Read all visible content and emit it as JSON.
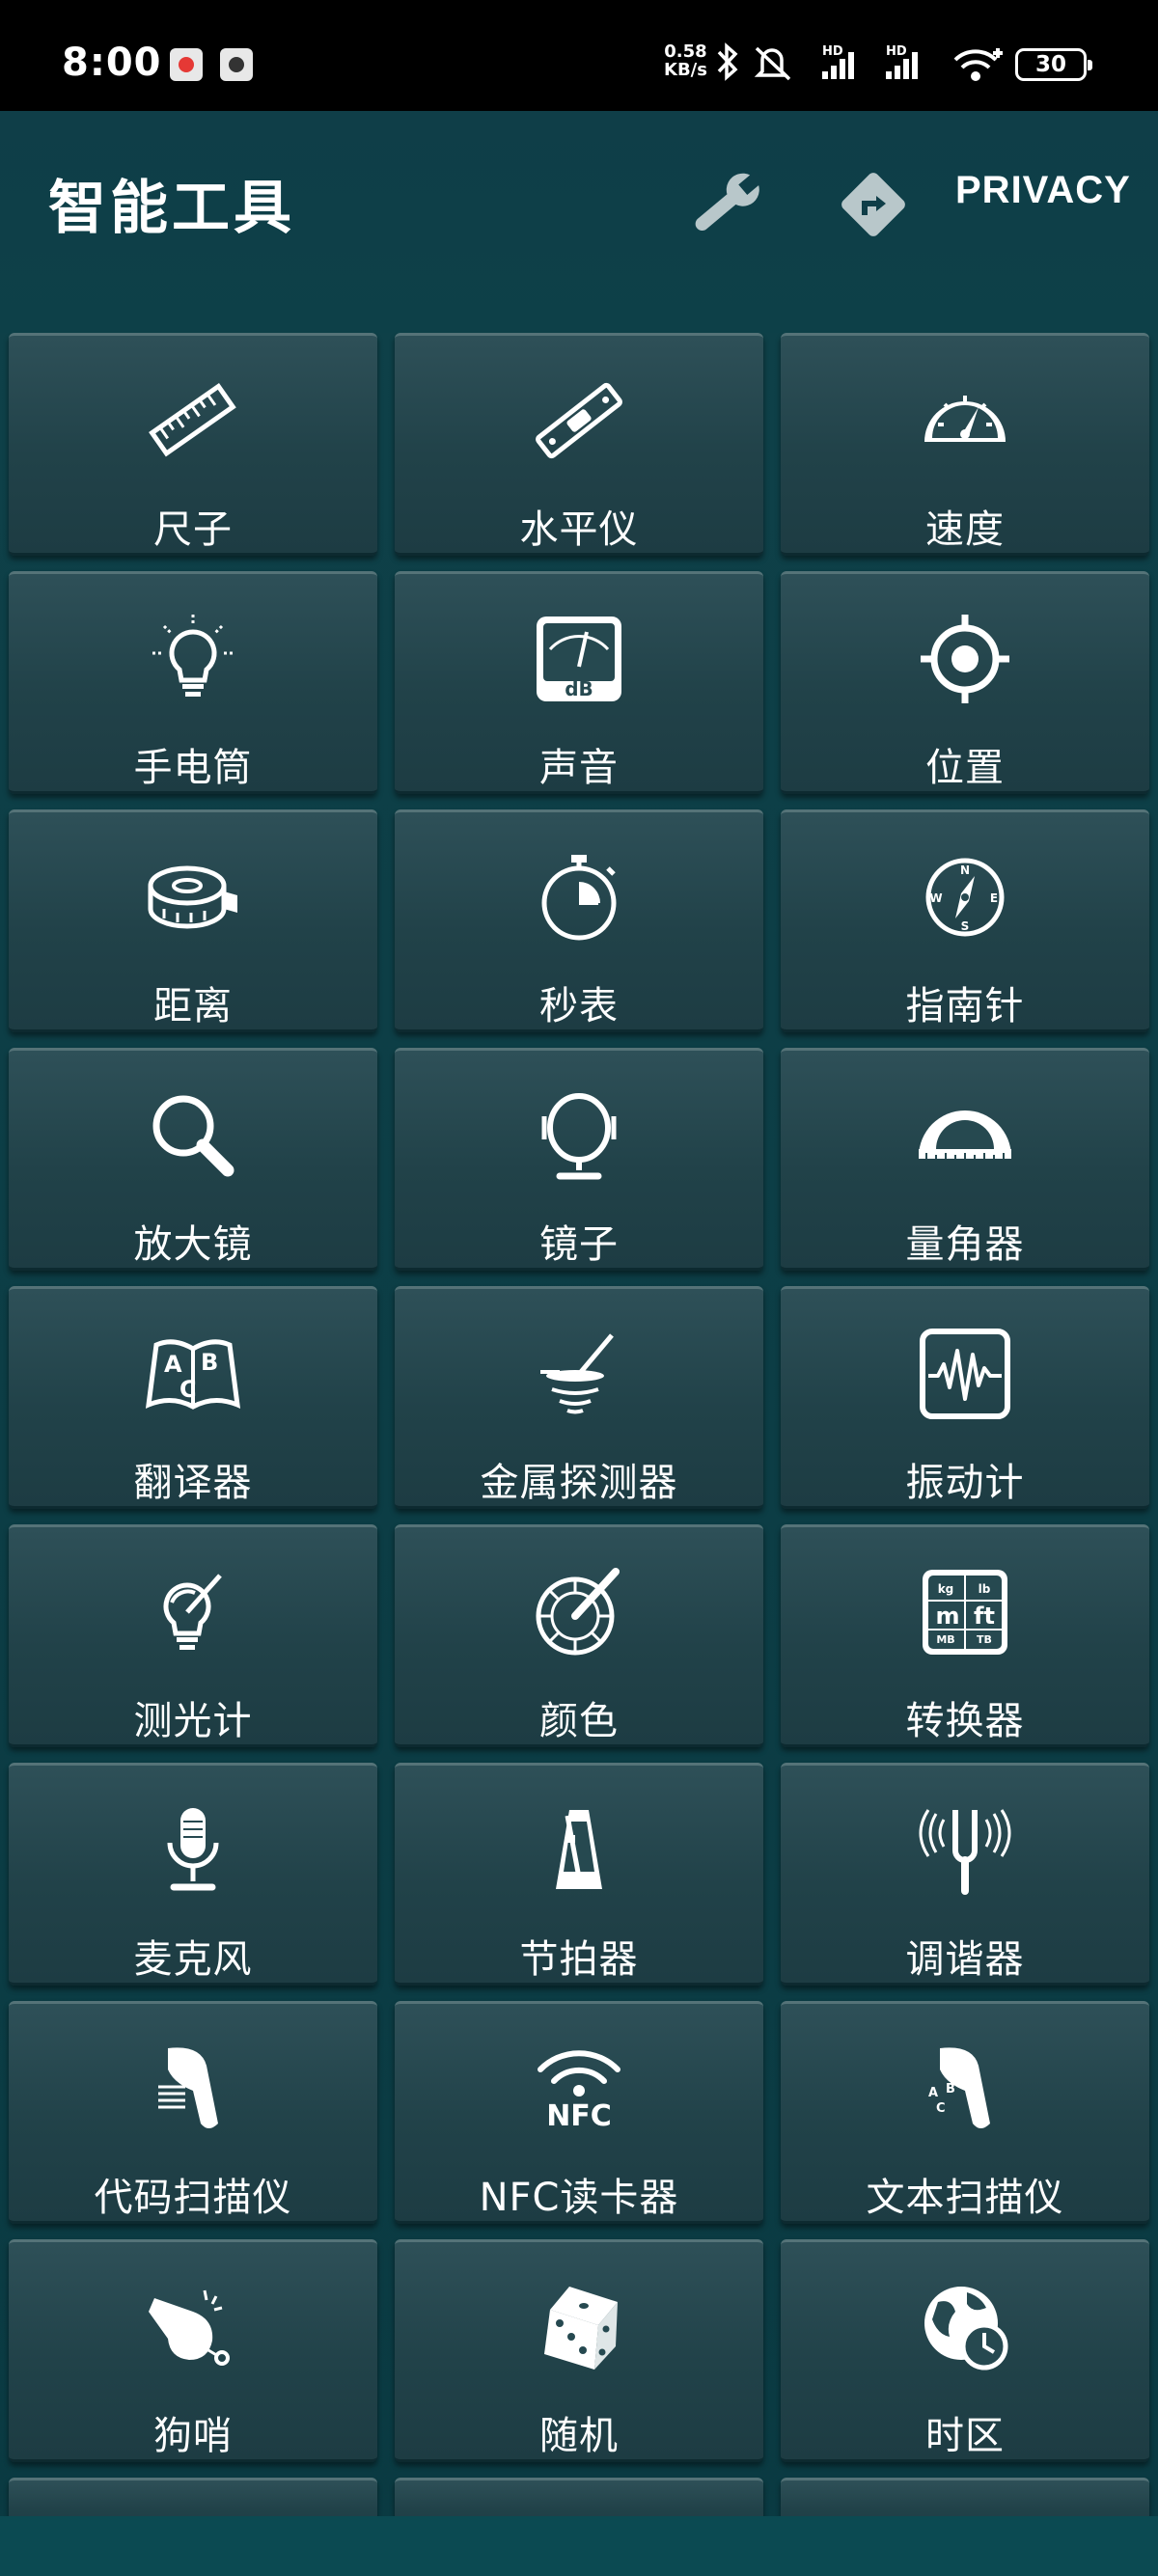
{
  "status_bar": {
    "time": "8:00",
    "net_speed_value": "0.58",
    "net_speed_unit": "KB/s",
    "signal_1_label": "HD",
    "signal_2_label": "HD",
    "battery": "30"
  },
  "header": {
    "title": "智能工具",
    "privacy_label": "PRIVACY"
  },
  "tools": [
    {
      "label": "尺子",
      "icon": "ruler-icon"
    },
    {
      "label": "水平仪",
      "icon": "level-icon"
    },
    {
      "label": "速度",
      "icon": "speedometer-icon"
    },
    {
      "label": "手电筒",
      "icon": "lightbulb-icon"
    },
    {
      "label": "声音",
      "icon": "decibel-meter-icon"
    },
    {
      "label": "位置",
      "icon": "location-target-icon"
    },
    {
      "label": "距离",
      "icon": "tape-measure-icon"
    },
    {
      "label": "秒表",
      "icon": "stopwatch-icon"
    },
    {
      "label": "指南针",
      "icon": "compass-icon"
    },
    {
      "label": "放大镜",
      "icon": "magnifier-icon"
    },
    {
      "label": "镜子",
      "icon": "mirror-icon"
    },
    {
      "label": "量角器",
      "icon": "protractor-icon"
    },
    {
      "label": "翻译器",
      "icon": "translate-book-icon"
    },
    {
      "label": "金属探测器",
      "icon": "metal-detector-icon"
    },
    {
      "label": "振动计",
      "icon": "vibration-icon"
    },
    {
      "label": "测光计",
      "icon": "light-meter-icon"
    },
    {
      "label": "颜色",
      "icon": "color-wheel-icon"
    },
    {
      "label": "转换器",
      "icon": "unit-converter-icon"
    },
    {
      "label": "麦克风",
      "icon": "microphone-icon"
    },
    {
      "label": "节拍器",
      "icon": "metronome-icon"
    },
    {
      "label": "调谐器",
      "icon": "tuning-fork-icon"
    },
    {
      "label": "代码扫描仪",
      "icon": "barcode-scanner-icon"
    },
    {
      "label": "NFC读卡器",
      "icon": "nfc-icon"
    },
    {
      "label": "文本扫描仪",
      "icon": "text-scanner-icon"
    },
    {
      "label": "狗哨",
      "icon": "whistle-icon"
    },
    {
      "label": "随机",
      "icon": "dice-icon"
    },
    {
      "label": "时区",
      "icon": "world-clock-icon"
    }
  ],
  "converter_icon_text": {
    "kg": "kg",
    "lb": "lb",
    "m": "m",
    "ft": "ft",
    "mb": "MB",
    "tb": "TB"
  },
  "decibel_text": "dB",
  "nfc_text": "NFC",
  "translate_text": {
    "a": "A",
    "b": "B",
    "c": "C"
  },
  "compass_text": {
    "n": "N",
    "s": "S",
    "e": "E",
    "w": "W"
  },
  "text_scanner_text": {
    "a": "A",
    "b": "B",
    "c": "C"
  }
}
